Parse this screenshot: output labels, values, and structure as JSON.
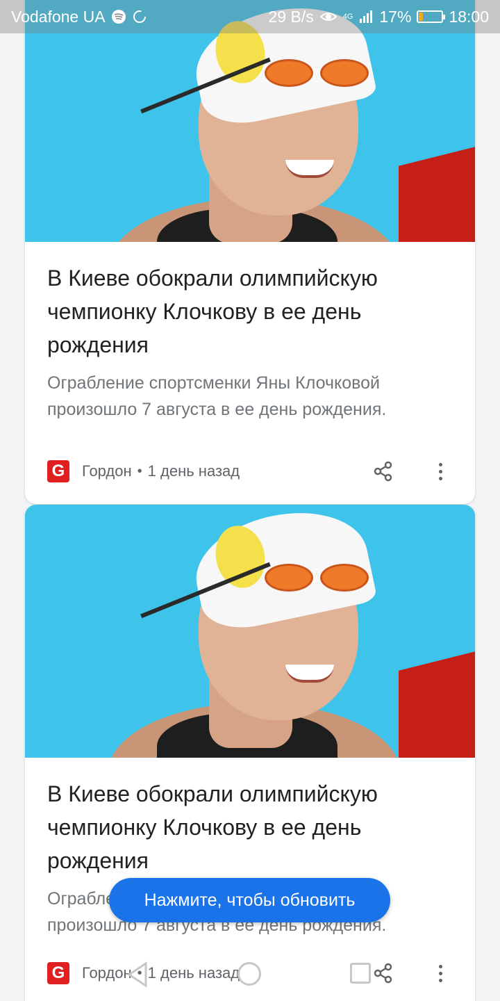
{
  "status_bar": {
    "carrier": "Vodafone UA",
    "speed": "29 B/s",
    "network": "4G",
    "battery_percent": "17%",
    "battery_level": 0.17,
    "time": "18:00"
  },
  "articles": [
    {
      "headline": "В Киеве обокрали олимпийскую чемпионку Клочкову в ее день рождения",
      "snippet": "Ограбление спортсменки Яны Клочковой произошло 7 августа в ее день рождения.",
      "source_logo": "G",
      "source": "Гордон",
      "separator": "•",
      "time_ago": "1 день назад"
    },
    {
      "headline": "В Киеве обокрали олимпийскую чемпионку Клочкову в ее день рождения",
      "snippet": "Ограбление спортсменки Яны Клочковой произошло 7 августа в ее день рождения.",
      "source_logo": "G",
      "source": "Гордон",
      "separator": "•",
      "time_ago": "1 день назад"
    }
  ],
  "refresh_button": {
    "label": "Нажмите, чтобы обновить"
  },
  "colors": {
    "accent": "#1a73e8",
    "source_logo": "#e02020",
    "photo_bg": "#3ec4ea"
  }
}
